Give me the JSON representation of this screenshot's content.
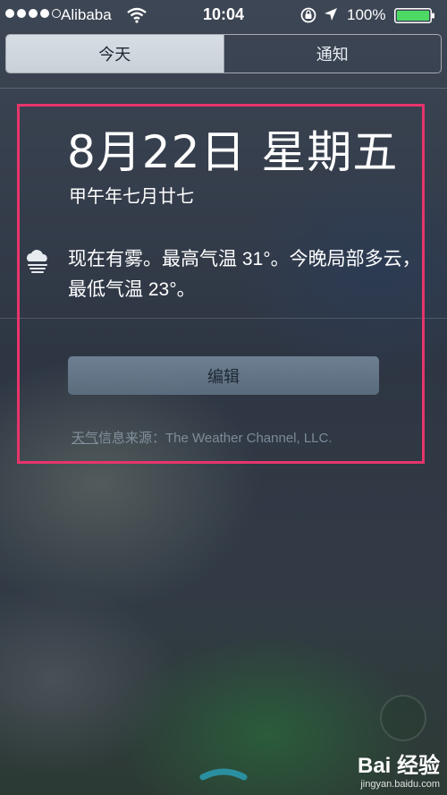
{
  "status_bar": {
    "carrier": "Alibaba",
    "time": "10:04",
    "battery_percent": "100%",
    "signal_bars_filled": 4,
    "signal_bars_total": 5,
    "battery_color": "#4cd964"
  },
  "tabs": [
    {
      "label": "今天",
      "active": true
    },
    {
      "label": "通知",
      "active": false
    }
  ],
  "widget": {
    "date_title": "8月22日 星期五",
    "lunar_date": "甲午年七月廿七",
    "weather_icon": "fog-cloud-icon",
    "weather_text": "现在有雾。最高气温 31°。今晚局部多云，最低气温 23°。",
    "edit_label": "编辑",
    "source_label": "天气",
    "source_text": "信息来源：The Weather Channel, LLC."
  },
  "highlight_color": "#e8346b",
  "watermark": {
    "logo_text": "Bai 经验",
    "url": "jingyan.baidu.com"
  }
}
